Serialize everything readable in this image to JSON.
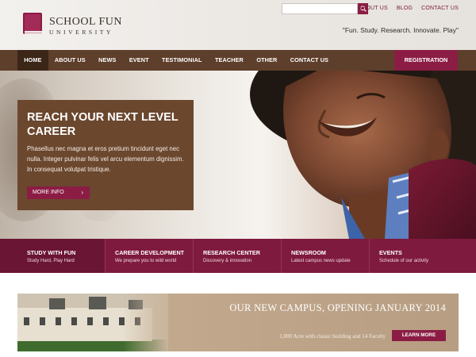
{
  "brand": {
    "name": "SCHOOL FUN",
    "sub": "UNIVERSITY",
    "tagline": "\"Fun. Study. Research. Innovate. Play\"",
    "accent_color": "#8b1d45",
    "nav_color": "#5e3f2b"
  },
  "search": {
    "placeholder": "",
    "icon": "search-icon"
  },
  "top_links": [
    {
      "label": "ABOUT US"
    },
    {
      "label": "BLOG"
    },
    {
      "label": "CONTACT US"
    }
  ],
  "nav": {
    "items": [
      {
        "label": "HOME",
        "active": true
      },
      {
        "label": "ABOUT US"
      },
      {
        "label": "NEWS"
      },
      {
        "label": "EVENT"
      },
      {
        "label": "TESTIMONIAL"
      },
      {
        "label": "TEACHER"
      },
      {
        "label": "OTHER"
      },
      {
        "label": "CONTACT US"
      }
    ],
    "registration": "REGISTRATION"
  },
  "hero": {
    "title": "REACH YOUR NEXT LEVEL CAREER",
    "text": "Phasellus nec magna et eros pretium tincidunt eget nec nulla. Integer pulvinar felis vel arcu elementum dignissim. In consequat volutpat tristique.",
    "button": "MORE INFO",
    "button_icon": "chevron-right-icon"
  },
  "features": [
    {
      "title": "STUDY WITH FUN",
      "sub": "Study Hard, Play Hard"
    },
    {
      "title": "CAREER DEVELOPMENT",
      "sub": "We prepare you to wild world"
    },
    {
      "title": "RESEARCH CENTER",
      "sub": "Discovery & innovation"
    },
    {
      "title": "NEWSROOM",
      "sub": "Latest campus news update"
    },
    {
      "title": "EVENTS",
      "sub": "Schedule of our activity"
    }
  ],
  "campus": {
    "title": "OUR NEW CAMPUS, OPENING JANUARY 2014",
    "sub": "1,000 Acre with classic building and 14 Faculty",
    "button": "LEARN MORE"
  }
}
